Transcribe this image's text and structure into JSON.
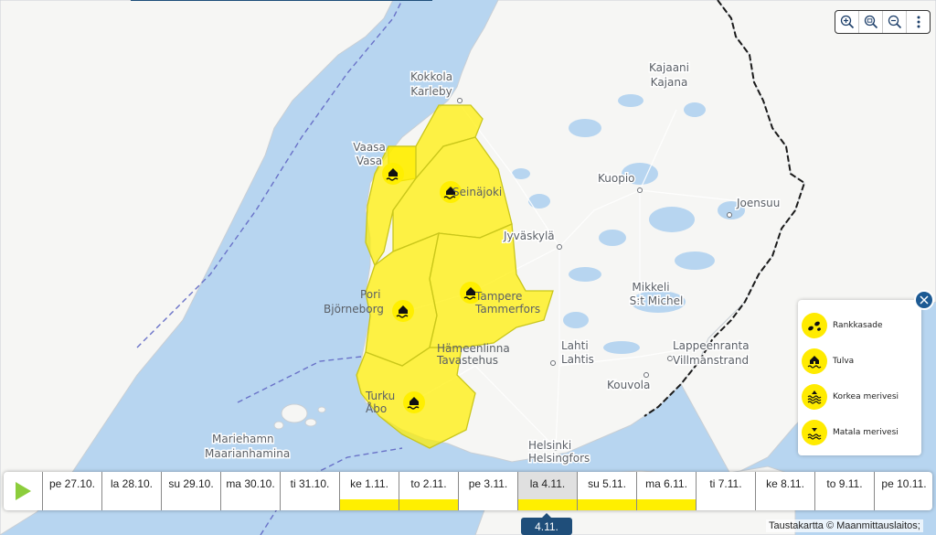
{
  "map": {
    "cities": [
      {
        "id": "kokkola",
        "lines": [
          "Kokkola",
          "Karleby"
        ]
      },
      {
        "id": "kajaani",
        "lines": [
          "Kajaani",
          "Kajana"
        ]
      },
      {
        "id": "vaasa",
        "lines": [
          "Vaasa",
          "Vasa"
        ]
      },
      {
        "id": "seinajoki",
        "lines": [
          "Seinäjoki"
        ]
      },
      {
        "id": "kuopio",
        "lines": [
          "Kuopio"
        ]
      },
      {
        "id": "joensuu",
        "lines": [
          "Joensuu"
        ]
      },
      {
        "id": "jyvaskyla",
        "lines": [
          "Jyväskylä"
        ]
      },
      {
        "id": "mikkeli",
        "lines": [
          "Mikkeli",
          "S:t Michel"
        ]
      },
      {
        "id": "pori",
        "lines": [
          "Pori",
          "Björneborg"
        ]
      },
      {
        "id": "tampere",
        "lines": [
          "Tampere",
          "Tammerfors"
        ]
      },
      {
        "id": "hameenlinna",
        "lines": [
          "Hämeenlinna",
          "Tavastehus"
        ]
      },
      {
        "id": "lahti",
        "lines": [
          "Lahti",
          "Lahtis"
        ]
      },
      {
        "id": "lappeenranta",
        "lines": [
          "Lappeenranta",
          "Villmanstrand"
        ]
      },
      {
        "id": "kouvola",
        "lines": [
          "Kouvola"
        ]
      },
      {
        "id": "turku",
        "lines": [
          "Turku",
          "Åbo"
        ]
      },
      {
        "id": "mariehamn",
        "lines": [
          "Mariehamn",
          "Maarianhamina"
        ]
      },
      {
        "id": "helsinki",
        "lines": [
          "Helsinki",
          "Helsingfors"
        ]
      }
    ],
    "warning_color": "#ffef00"
  },
  "zoom_controls": [
    {
      "id": "zoom-in",
      "icon": "zoom-in-icon"
    },
    {
      "id": "zoom-reset",
      "icon": "zoom-reset-icon"
    },
    {
      "id": "zoom-out",
      "icon": "zoom-out-icon"
    },
    {
      "id": "more",
      "icon": "more-vertical-icon"
    }
  ],
  "legend": {
    "items": [
      {
        "label": "Rankkasade",
        "icon": "heavy-rain-icon"
      },
      {
        "label": "Tulva",
        "icon": "flood-icon"
      },
      {
        "label": "Korkea merivesi",
        "icon": "high-sea-level-icon"
      },
      {
        "label": "Matala merivesi",
        "icon": "low-sea-level-icon"
      }
    ]
  },
  "timeline": {
    "days": [
      {
        "label": "pe 27.10.",
        "warning": false,
        "selected": false
      },
      {
        "label": "la 28.10.",
        "warning": false,
        "selected": false
      },
      {
        "label": "su 29.10.",
        "warning": false,
        "selected": false
      },
      {
        "label": "ma 30.10.",
        "warning": false,
        "selected": false
      },
      {
        "label": "ti 31.10.",
        "warning": false,
        "selected": false
      },
      {
        "label": "ke 1.11.",
        "warning": true,
        "selected": false
      },
      {
        "label": "to 2.11.",
        "warning": true,
        "selected": false
      },
      {
        "label": "pe 3.11.",
        "warning": false,
        "selected": false
      },
      {
        "label": "la 4.11.",
        "warning": true,
        "selected": true
      },
      {
        "label": "su 5.11.",
        "warning": true,
        "selected": false
      },
      {
        "label": "ma 6.11.",
        "warning": true,
        "selected": false
      },
      {
        "label": "ti 7.11.",
        "warning": false,
        "selected": false
      },
      {
        "label": "ke 8.11.",
        "warning": false,
        "selected": false
      },
      {
        "label": "to 9.11.",
        "warning": false,
        "selected": false
      },
      {
        "label": "pe 10.11.",
        "warning": false,
        "selected": false
      }
    ],
    "selected_date": "4.11."
  },
  "attribution": "Taustakartta © Maanmittauslaitos;"
}
